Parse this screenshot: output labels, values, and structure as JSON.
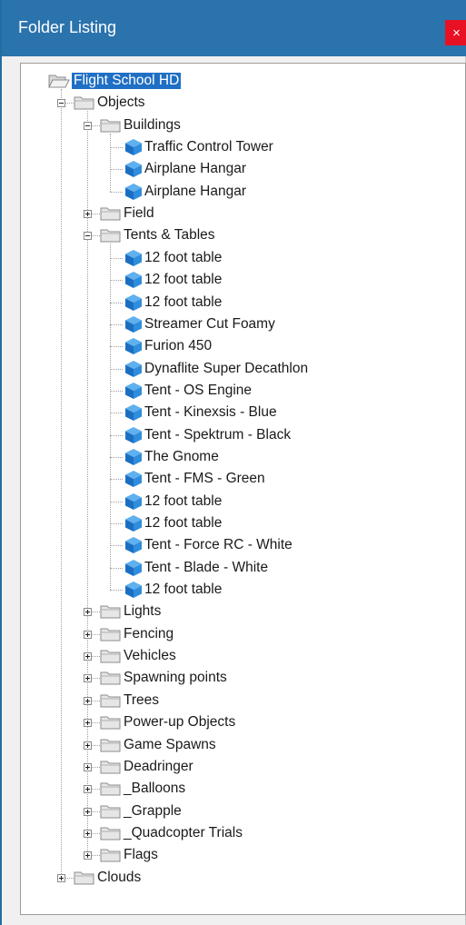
{
  "window": {
    "title": "Folder Listing",
    "close_label": "×"
  },
  "tree": [
    {
      "label": "Flight School HD",
      "level": 0,
      "kind": "folder-open",
      "selected": true
    },
    {
      "label": "Objects",
      "level": 1,
      "kind": "folder",
      "state": "expanded"
    },
    {
      "label": "Buildings",
      "level": 2,
      "kind": "folder",
      "state": "expanded"
    },
    {
      "label": "Traffic Control Tower",
      "level": 3,
      "kind": "object"
    },
    {
      "label": "Airplane Hangar",
      "level": 3,
      "kind": "object"
    },
    {
      "label": "Airplane Hangar",
      "level": 3,
      "kind": "object"
    },
    {
      "label": "Field",
      "level": 2,
      "kind": "folder",
      "state": "collapsed"
    },
    {
      "label": "Tents & Tables",
      "level": 2,
      "kind": "folder",
      "state": "expanded"
    },
    {
      "label": "12 foot table",
      "level": 3,
      "kind": "object"
    },
    {
      "label": "12 foot table",
      "level": 3,
      "kind": "object"
    },
    {
      "label": "12 foot table",
      "level": 3,
      "kind": "object"
    },
    {
      "label": "Streamer Cut Foamy",
      "level": 3,
      "kind": "object"
    },
    {
      "label": "Furion 450",
      "level": 3,
      "kind": "object"
    },
    {
      "label": "Dynaflite Super Decathlon",
      "level": 3,
      "kind": "object"
    },
    {
      "label": "Tent - OS Engine",
      "level": 3,
      "kind": "object"
    },
    {
      "label": "Tent - Kinexsis - Blue",
      "level": 3,
      "kind": "object"
    },
    {
      "label": "Tent - Spektrum - Black",
      "level": 3,
      "kind": "object"
    },
    {
      "label": "The Gnome",
      "level": 3,
      "kind": "object"
    },
    {
      "label": "Tent - FMS - Green",
      "level": 3,
      "kind": "object"
    },
    {
      "label": "12 foot table",
      "level": 3,
      "kind": "object"
    },
    {
      "label": "12 foot table",
      "level": 3,
      "kind": "object"
    },
    {
      "label": "Tent - Force RC - White",
      "level": 3,
      "kind": "object"
    },
    {
      "label": "Tent - Blade - White",
      "level": 3,
      "kind": "object"
    },
    {
      "label": "12 foot table",
      "level": 3,
      "kind": "object"
    },
    {
      "label": "Lights",
      "level": 2,
      "kind": "folder",
      "state": "collapsed"
    },
    {
      "label": "Fencing",
      "level": 2,
      "kind": "folder",
      "state": "collapsed"
    },
    {
      "label": "Vehicles",
      "level": 2,
      "kind": "folder",
      "state": "collapsed"
    },
    {
      "label": "Spawning points",
      "level": 2,
      "kind": "folder",
      "state": "collapsed"
    },
    {
      "label": "Trees",
      "level": 2,
      "kind": "folder",
      "state": "collapsed"
    },
    {
      "label": "Power-up Objects",
      "level": 2,
      "kind": "folder",
      "state": "collapsed"
    },
    {
      "label": "Game Spawns",
      "level": 2,
      "kind": "folder",
      "state": "collapsed"
    },
    {
      "label": "Deadringer",
      "level": 2,
      "kind": "folder",
      "state": "collapsed"
    },
    {
      "label": "_Balloons",
      "level": 2,
      "kind": "folder",
      "state": "collapsed"
    },
    {
      "label": "_Grapple",
      "level": 2,
      "kind": "folder",
      "state": "collapsed"
    },
    {
      "label": "_Quadcopter Trials",
      "level": 2,
      "kind": "folder",
      "state": "collapsed"
    },
    {
      "label": "Flags",
      "level": 2,
      "kind": "folder",
      "state": "collapsed"
    },
    {
      "label": "Clouds",
      "level": 1,
      "kind": "folder",
      "state": "collapsed"
    }
  ],
  "colors": {
    "titlebar": "#2b73ad",
    "selection": "#1f6fc4",
    "object_icon": "#1e78c8"
  },
  "icons": {
    "folder": "folder-icon",
    "folder_open": "open-folder-icon",
    "object": "cube-icon",
    "expand": "plus-box-icon",
    "collapse": "minus-box-icon"
  }
}
